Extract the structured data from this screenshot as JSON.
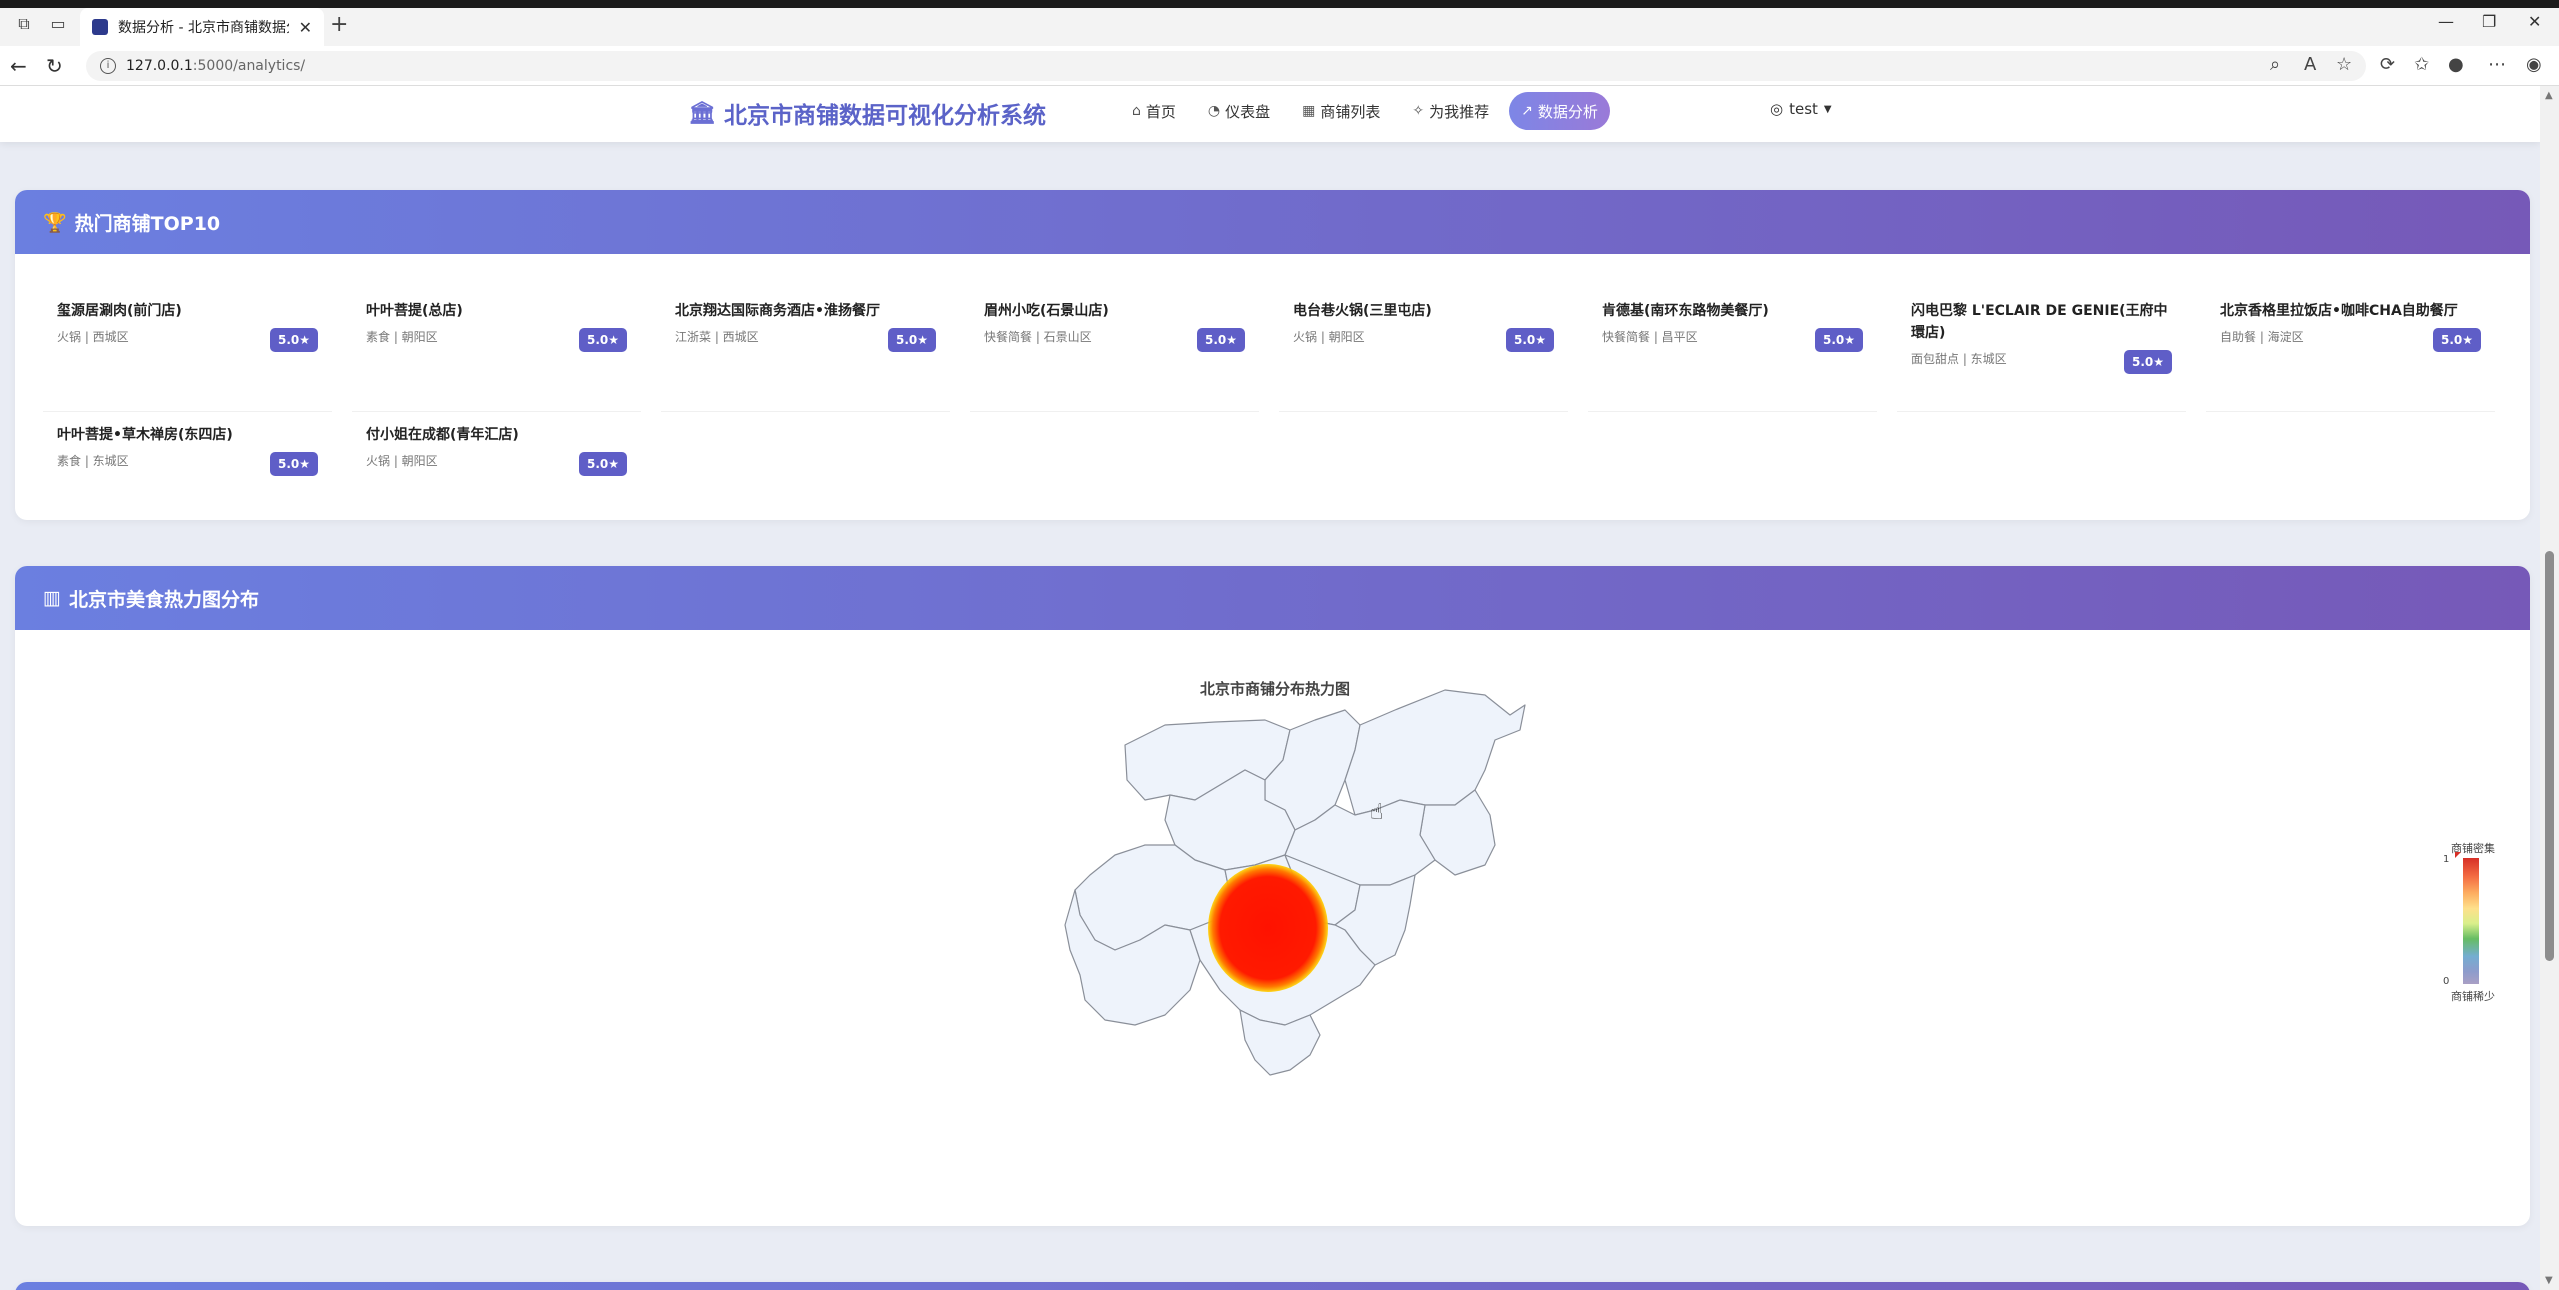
{
  "browser": {
    "tab_title": "数据分析 - 北京市商铺数据分析系统",
    "url_host": "127.0.0.1",
    "url_rest": ":5000/analytics/"
  },
  "navbar": {
    "brand": "北京市商铺数据可视化分析系统",
    "items": [
      {
        "label": "首页",
        "icon": "home-icon",
        "active": false
      },
      {
        "label": "仪表盘",
        "icon": "dashboard-icon",
        "active": false
      },
      {
        "label": "商铺列表",
        "icon": "shop-icon",
        "active": false
      },
      {
        "label": "为我推荐",
        "icon": "lightbulb-icon",
        "active": false
      },
      {
        "label": "数据分析",
        "icon": "chart-line-icon",
        "active": true
      }
    ],
    "user": "test"
  },
  "top10": {
    "title": "热门商铺TOP10",
    "shops": [
      {
        "name": "玺源居涮肉(前门店)",
        "meta": "火锅 | 西城区",
        "score": "5.0★"
      },
      {
        "name": "叶叶菩提(总店)",
        "meta": "素食 | 朝阳区",
        "score": "5.0★"
      },
      {
        "name": "北京翔达国际商务酒店•淮扬餐厅",
        "meta": "江浙菜 | 西城区",
        "score": "5.0★"
      },
      {
        "name": "眉州小吃(石景山店)",
        "meta": "快餐简餐 | 石景山区",
        "score": "5.0★"
      },
      {
        "name": "电台巷火锅(三里屯店)",
        "meta": "火锅 | 朝阳区",
        "score": "5.0★"
      },
      {
        "name": "肯德基(南环东路物美餐厅)",
        "meta": "快餐简餐 | 昌平区",
        "score": "5.0★"
      },
      {
        "name": "闪电巴黎 L'ECLAIR DE GENIE(王府中環店)",
        "meta": "面包甜点 | 东城区",
        "score": "5.0★"
      },
      {
        "name": "北京香格里拉饭店•咖啡CHA自助餐厅",
        "meta": "自助餐 | 海淀区",
        "score": "5.0★"
      },
      {
        "name": "叶叶菩提•草木禅房(东四店)",
        "meta": "素食 | 东城区",
        "score": "5.0★"
      },
      {
        "name": "付小姐在成都(青年汇店)",
        "meta": "火锅 | 朝阳区",
        "score": "5.0★"
      }
    ]
  },
  "heatmap": {
    "section_title": "北京市美食热力图分布",
    "chart_title": "北京市商铺分布热力图",
    "visual_map": {
      "top_label": "商铺密集",
      "bottom_label": "商铺稀少",
      "max": "1",
      "min": "0"
    },
    "colors": {
      "hot": "#ff1400",
      "edge": "#ffd000",
      "region_fill": "#eef3fb",
      "region_stroke": "#8a8f99"
    }
  }
}
